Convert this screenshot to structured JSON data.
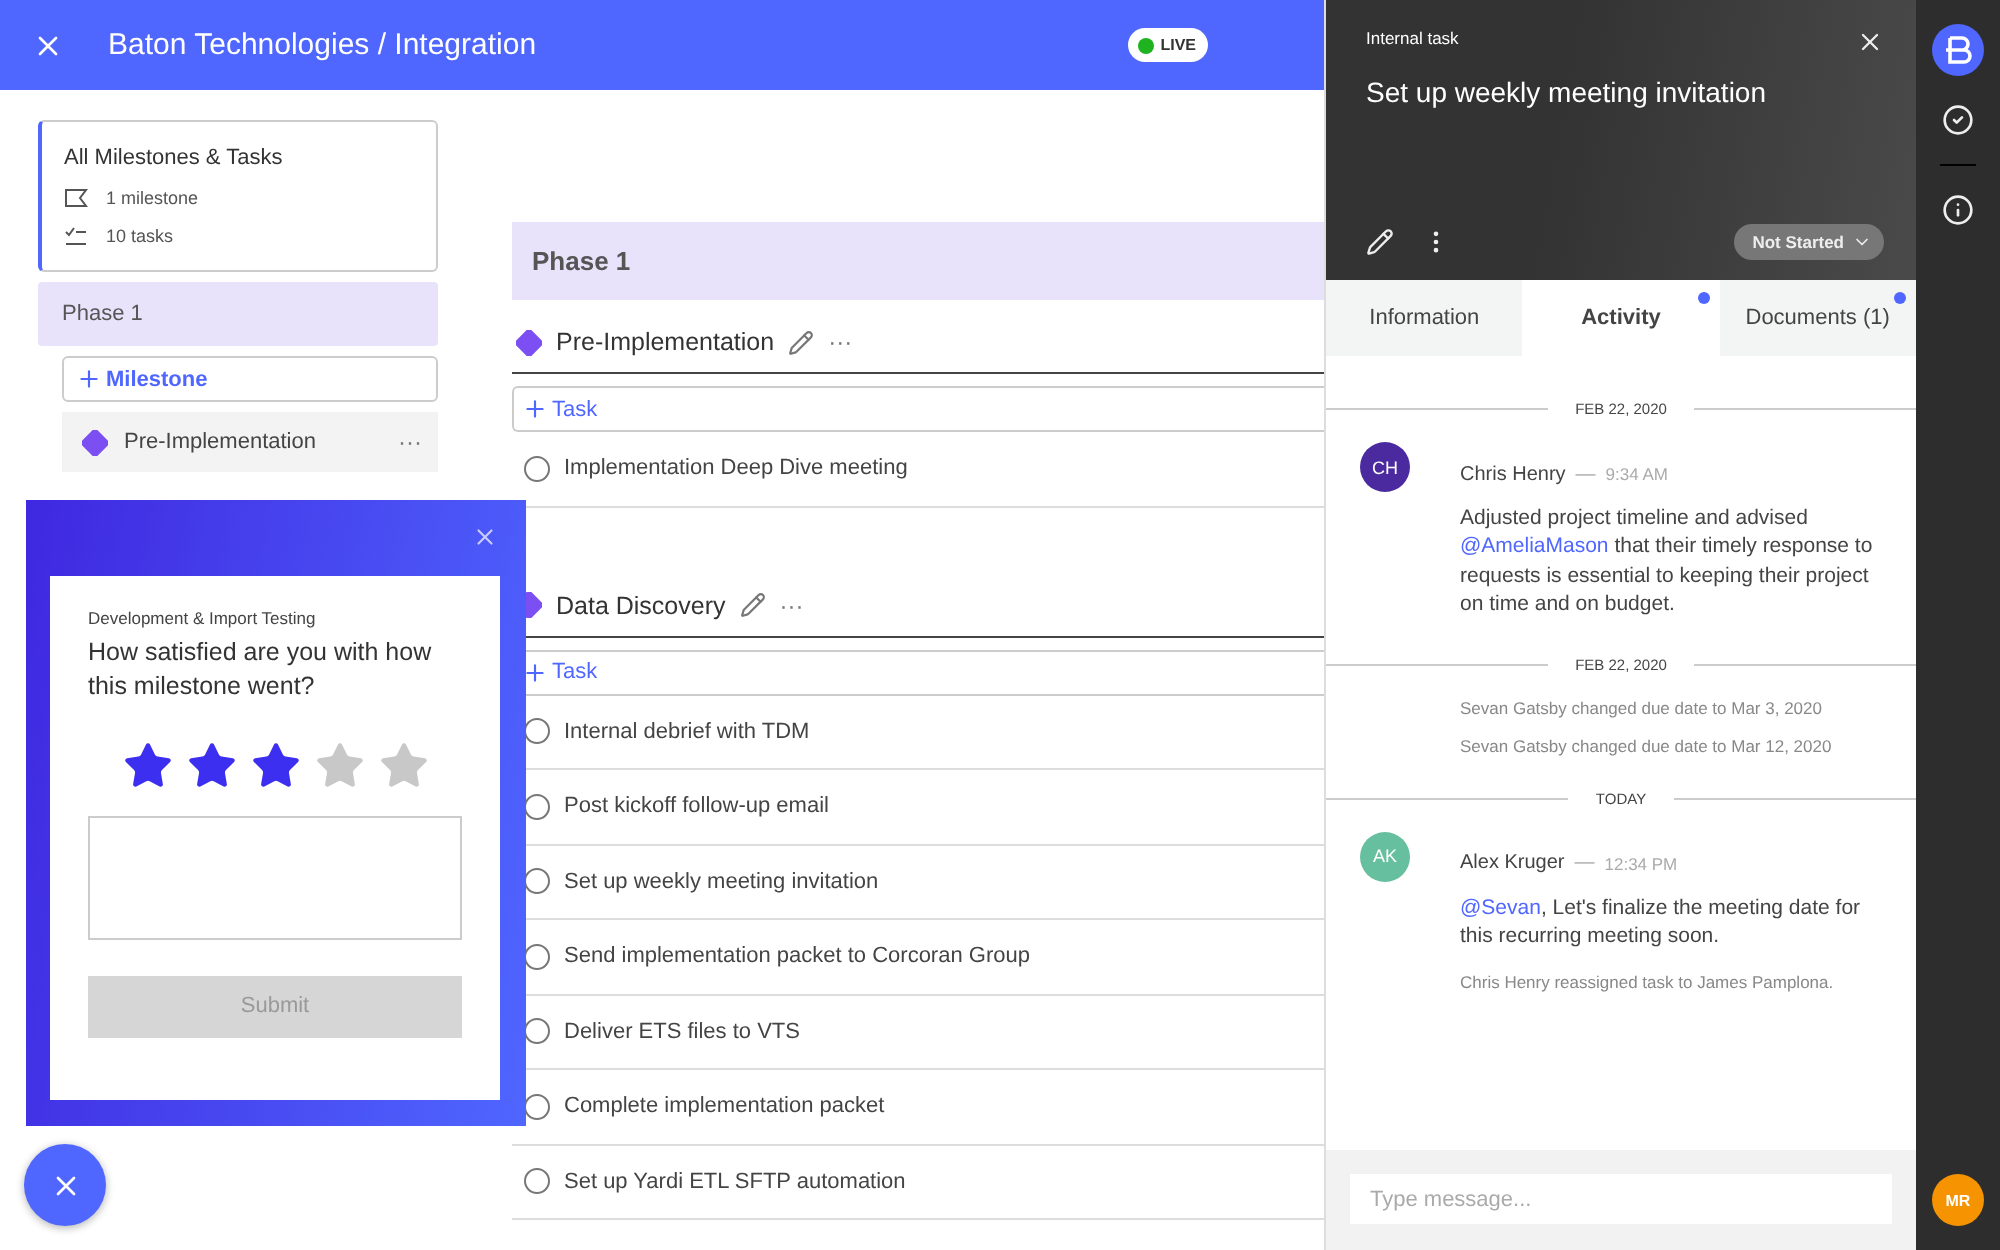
{
  "header": {
    "title": "Baton Technologies / Integration",
    "status_badge": "LIVE"
  },
  "sidebar": {
    "summary": {
      "title": "All Milestones & Tasks",
      "items": [
        {
          "kind": "milestone",
          "text": "1 milestone"
        },
        {
          "kind": "tasks",
          "text": "10 tasks"
        }
      ]
    },
    "phases": [
      {
        "label": "Phase 1",
        "selected": true
      }
    ],
    "add_milestone": "Milestone",
    "milestones": [
      {
        "name": "Pre-Implementation",
        "more": "···"
      }
    ]
  },
  "main": {
    "phase_title": "Phase 1",
    "milestones": [
      {
        "name": "Pre-Implementation",
        "more": "···",
        "add_task": "Task",
        "tasks": [
          {
            "title": "Implementation Deep Dive meeting",
            "checked": false
          }
        ]
      },
      {
        "name": "Data Discovery",
        "more": "···",
        "add_task": "Task",
        "tasks": [
          {
            "title": "Internal debrief with TDM",
            "checked": false
          },
          {
            "title": "Post kickoff follow-up email",
            "checked": false
          },
          {
            "title": "Set up weekly meeting invitation",
            "checked": false
          },
          {
            "title": "Send implementation packet to Corcoran Group",
            "checked": false
          },
          {
            "title": "Deliver ETS files to VTS",
            "checked": false
          },
          {
            "title": "Complete implementation packet",
            "checked": false
          },
          {
            "title": "Set up Yardi ETL SFTP automation",
            "checked": false
          }
        ]
      }
    ]
  },
  "survey": {
    "category": "Development & Import Testing",
    "question": "How satisfied are you with how this milestone went?",
    "stars": 3,
    "submit": {
      "label": "Submit",
      "disabled": true
    }
  },
  "task_panel": {
    "label": "Internal task",
    "title": "Set up weekly meeting invitation",
    "status": "Not Started",
    "tabs": [
      {
        "label": "Information",
        "selected": false,
        "unread": false
      },
      {
        "label": "Activity",
        "selected": true,
        "unread": true
      },
      {
        "label": "Documents (1)",
        "selected": false,
        "unread": true
      }
    ],
    "activity": [
      {
        "kind": "date",
        "text": "FEB 22, 2020"
      },
      {
        "kind": "comment",
        "initials": "CH",
        "color": "#4b2aa0",
        "author": "Chris Henry",
        "separator": "—",
        "time": "9:34 AM",
        "body": [
          {
            "kind": "text",
            "text": "Adjusted project timeline and advised"
          },
          {
            "kind": "mention",
            "text": "@AmeliaMason"
          },
          {
            "kind": "text",
            "text": "that their timely response to requests is essential to keeping their project on time and on budget."
          }
        ]
      },
      {
        "kind": "date",
        "text": "FEB 22, 2020"
      },
      {
        "kind": "event",
        "text": "Sevan Gatsby changed due date to Mar 3, 2020"
      },
      {
        "kind": "event",
        "text": "Sevan Gatsby changed due date to Mar 12, 2020"
      },
      {
        "kind": "date",
        "text": "TODAY"
      },
      {
        "kind": "comment",
        "initials": "AK",
        "color": "#66bf9e",
        "author": "Alex Kruger",
        "separator": "—",
        "time": "12:34 PM",
        "body": [
          {
            "kind": "mention",
            "text": "@Sevan"
          },
          {
            "kind": "text",
            "text": ", Let's finalize the meeting date for this recurring meeting soon."
          }
        ]
      },
      {
        "kind": "event",
        "text": "Chris Henry reassigned task to James Pamplona."
      }
    ],
    "message_placeholder": "Type message..."
  },
  "rail": {
    "user_initials": "MR"
  }
}
